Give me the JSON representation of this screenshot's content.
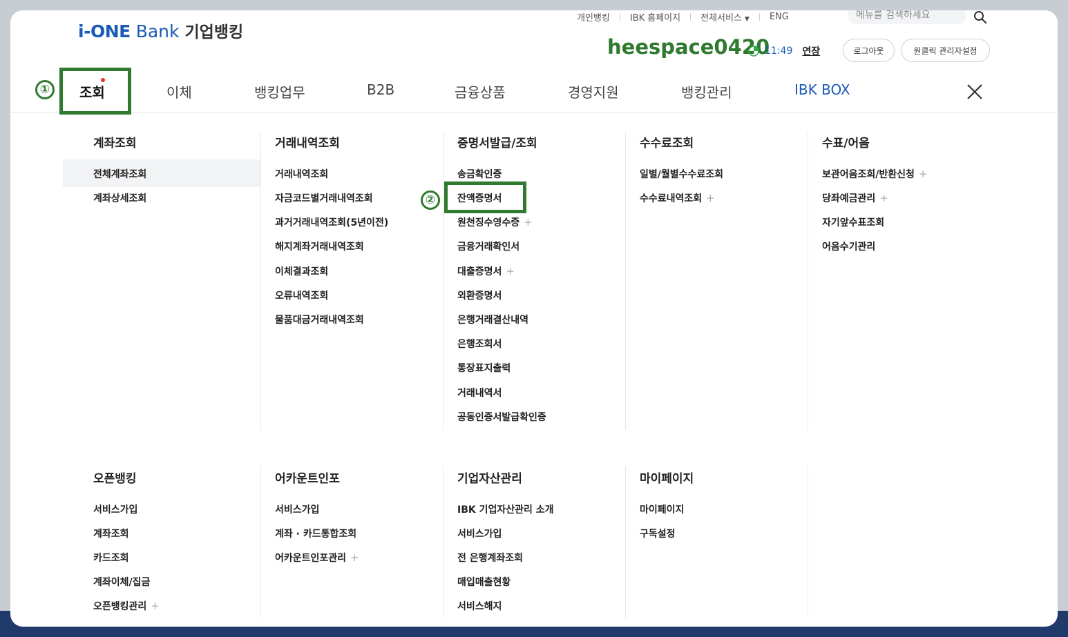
{
  "header": {
    "logo_ione": "i-ONE",
    "logo_bank": "Bank",
    "logo_biz": "기업뱅킹",
    "util_links": [
      "개인뱅킹",
      "IBK 홈페이지",
      "전체서비스",
      "ENG"
    ],
    "search_placeholder": "메뉴를 검색하세요",
    "username": "heespace0420",
    "timer": "11:49",
    "extend": "연장",
    "logout": "로그아웃",
    "oneclick": "원클릭 관리자설정"
  },
  "gnb": [
    "조회",
    "이체",
    "뱅킹업무",
    "B2B",
    "금융상품",
    "경영지원",
    "뱅킹관리",
    "IBK BOX"
  ],
  "annotations": {
    "badge1": "①",
    "badge2": "②"
  },
  "sections_row1": [
    {
      "title": "계좌조회",
      "items": [
        "전체계좌조회",
        "계좌상세조회"
      ]
    },
    {
      "title": "거래내역조회",
      "items": [
        "거래내역조회",
        "자금코드별거래내역조회",
        "과거거래내역조회(5년이전)",
        "해지계좌거래내역조회",
        "이체결과조회",
        "오류내역조회",
        "물품대금거래내역조회"
      ]
    },
    {
      "title": "증명서발급/조회",
      "items": [
        "송금확인증",
        "잔액증명서",
        "원천징수영수증",
        "금융거래확인서",
        "대출증명서",
        "외환증명서",
        "은행거래결산내역",
        "은행조회서",
        "통장표지출력",
        "거래내역서",
        "공동인증서발급확인증"
      ]
    },
    {
      "title": "수수료조회",
      "items": [
        "일별/월별수수료조회",
        "수수료내역조회"
      ]
    },
    {
      "title": "수표/어음",
      "items": [
        "보관어음조회/반환신청",
        "당좌예금관리",
        "자기앞수표조회",
        "어음수기관리"
      ]
    }
  ],
  "sections_row2": [
    {
      "title": "오픈뱅킹",
      "items": [
        "서비스가입",
        "계좌조회",
        "카드조회",
        "계좌이체/집금",
        "오픈뱅킹관리"
      ]
    },
    {
      "title": "어카운트인포",
      "items": [
        "서비스가입",
        "계좌 · 카드통합조회",
        "어카운트인포관리"
      ]
    },
    {
      "title": "기업자산관리",
      "items": [
        "IBK 기업자산관리 소개",
        "서비스가입",
        "전 은행계좌조회",
        "매입매출현황",
        "서비스해지"
      ]
    },
    {
      "title": "마이페이지",
      "items": [
        "마이페이지",
        "구독설정"
      ]
    }
  ],
  "plus_symbol": "+"
}
